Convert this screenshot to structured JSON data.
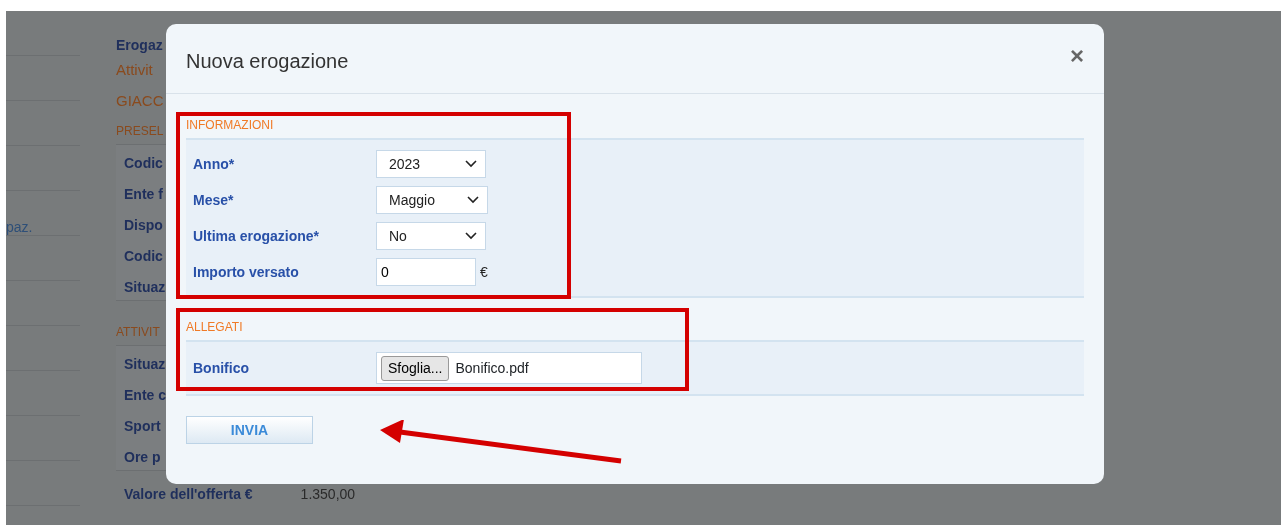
{
  "background": {
    "side_text": "paz.",
    "heading": "Erogaz",
    "subheading": "Attivit",
    "name": "GIACC",
    "sections": [
      {
        "title": "PRESEL",
        "rows": [
          {
            "label": "Codic"
          },
          {
            "label": "Ente f"
          },
          {
            "label": "Dispo"
          },
          {
            "label": "Codic"
          },
          {
            "label": "Situaz"
          }
        ]
      },
      {
        "title": "ATTIVIT",
        "rows": [
          {
            "label": "Situaz"
          },
          {
            "label": "Ente c"
          },
          {
            "label": "Sport"
          },
          {
            "label": "Ore p"
          },
          {
            "label": "Valore dell'offerta €",
            "value": "1.350,00"
          }
        ]
      }
    ]
  },
  "modal": {
    "title": "Nuova erogazione",
    "close": "×",
    "sections": [
      {
        "title": "INFORMAZIONI",
        "fields": [
          {
            "kind": "select",
            "label": "Anno*",
            "value": "2023"
          },
          {
            "kind": "select",
            "label": "Mese*",
            "value": "Maggio"
          },
          {
            "kind": "select",
            "label": "Ultima erogazione*",
            "value": "No"
          },
          {
            "kind": "number",
            "label": "Importo versato",
            "value": "0",
            "unit": "€"
          }
        ]
      },
      {
        "title": "ALLEGATI",
        "fields": [
          {
            "kind": "file",
            "label": "Bonifico",
            "button": "Sfoglia...",
            "value": "Bonifico.pdf"
          }
        ]
      }
    ],
    "submit": "INVIA"
  }
}
